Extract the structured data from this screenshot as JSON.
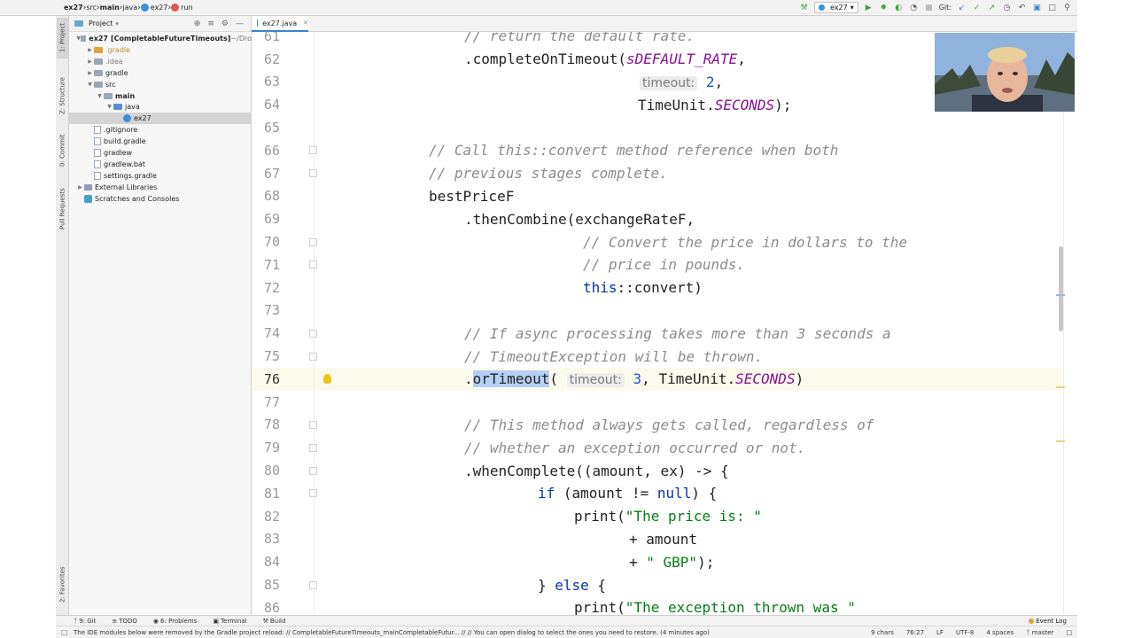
{
  "breadcrumbs": [
    {
      "label": "ex27",
      "icon": "none",
      "bold": true
    },
    {
      "label": "src",
      "icon": "none",
      "bold": false
    },
    {
      "label": "main",
      "icon": "none",
      "bold": true
    },
    {
      "label": "java",
      "icon": "none",
      "bold": false
    },
    {
      "label": "ex27",
      "icon": "class-icon",
      "bold": false
    },
    {
      "label": "run",
      "icon": "method-icon",
      "bold": false
    }
  ],
  "toolbar": {
    "run_config": "ex27",
    "git_label": "Git:"
  },
  "tool_windows": {
    "project": "1: Project",
    "structure": "Z: Structure",
    "commit": "0: Commit",
    "pull_requests": "Pull Requests",
    "favorites": "2: Favorites"
  },
  "project_panel": {
    "title": "Project",
    "tree": [
      {
        "label": "ex27",
        "extra": "[CompletableFutureTimeouts]",
        "suffix": " ~/Dro",
        "depth": 0,
        "arrow": "open",
        "icon": "folder-gray"
      },
      {
        "label": ".gradle",
        "extra": "",
        "suffix": "",
        "depth": 1,
        "arrow": "closed",
        "icon": "folder-orange"
      },
      {
        "label": ".idea",
        "extra": "",
        "suffix": "",
        "depth": 1,
        "arrow": "closed",
        "icon": "folder-gray"
      },
      {
        "label": "gradle",
        "extra": "",
        "suffix": "",
        "depth": 1,
        "arrow": "closed",
        "icon": "folder-gray"
      },
      {
        "label": "src",
        "extra": "",
        "suffix": "",
        "depth": 1,
        "arrow": "open",
        "icon": "folder-gray"
      },
      {
        "label": "main",
        "extra": "",
        "suffix": "",
        "depth": 2,
        "arrow": "open",
        "icon": "folder-gray"
      },
      {
        "label": "java",
        "extra": "",
        "suffix": "",
        "depth": 3,
        "arrow": "open",
        "icon": "folder-blue"
      },
      {
        "label": "ex27",
        "extra": "",
        "suffix": "",
        "depth": 4,
        "arrow": "none",
        "icon": "class",
        "selected": true
      },
      {
        "label": ".gitignore",
        "extra": "",
        "suffix": "",
        "depth": 1,
        "arrow": "none",
        "icon": "file"
      },
      {
        "label": "build.gradle",
        "extra": "",
        "suffix": "",
        "depth": 1,
        "arrow": "none",
        "icon": "file"
      },
      {
        "label": "gradlew",
        "extra": "",
        "suffix": "",
        "depth": 1,
        "arrow": "none",
        "icon": "file"
      },
      {
        "label": "gradlew.bat",
        "extra": "",
        "suffix": "",
        "depth": 1,
        "arrow": "none",
        "icon": "file"
      },
      {
        "label": "settings.gradle",
        "extra": "",
        "suffix": "",
        "depth": 1,
        "arrow": "none",
        "icon": "file"
      },
      {
        "label": "External Libraries",
        "extra": "",
        "suffix": "",
        "depth": 0,
        "arrow": "closed",
        "icon": "library"
      },
      {
        "label": "Scratches and Consoles",
        "extra": "",
        "suffix": "",
        "depth": 0,
        "arrow": "none",
        "icon": "scratch"
      }
    ]
  },
  "editor": {
    "tab_label": "ex27.java",
    "current_line": "76",
    "lines": [
      {
        "n": "61",
        "segs": [
          [
            "c",
            "// return the default rate."
          ]
        ],
        "indent": 524
      },
      {
        "n": "62",
        "segs": [
          [
            "p",
            ".completeOnTimeout("
          ],
          [
            "f",
            "sDEFAULT_RATE"
          ],
          [
            "p",
            ","
          ]
        ],
        "indent": 524
      },
      {
        "n": "63",
        "segs": [
          [
            "h",
            "timeout:"
          ],
          [
            "p",
            " "
          ],
          [
            "n",
            "2"
          ],
          [
            "p",
            ","
          ]
        ],
        "indent": 722
      },
      {
        "n": "64",
        "segs": [
          [
            "p",
            "TimeUnit."
          ],
          [
            "f",
            "SECONDS"
          ],
          [
            "p",
            ");"
          ]
        ],
        "indent": 720
      },
      {
        "n": "65",
        "segs": [],
        "indent": 484
      },
      {
        "n": "66",
        "segs": [
          [
            "c",
            "// Call this::convert method reference when both"
          ]
        ],
        "indent": 484,
        "fold": true
      },
      {
        "n": "67",
        "segs": [
          [
            "c",
            "// previous stages complete."
          ]
        ],
        "indent": 484,
        "fold": true
      },
      {
        "n": "68",
        "segs": [
          [
            "p",
            "bestPriceF"
          ]
        ],
        "indent": 484
      },
      {
        "n": "69",
        "segs": [
          [
            "p",
            ".thenCombine(exchangeRateF,"
          ]
        ],
        "indent": 524
      },
      {
        "n": "70",
        "segs": [
          [
            "c",
            "// Convert the price in dollars to the"
          ]
        ],
        "indent": 658,
        "fold": true
      },
      {
        "n": "71",
        "segs": [
          [
            "c",
            "// price in pounds."
          ]
        ],
        "indent": 658,
        "fold": true
      },
      {
        "n": "72",
        "segs": [
          [
            "k",
            "this"
          ],
          [
            "p",
            "::convert)"
          ]
        ],
        "indent": 658
      },
      {
        "n": "73",
        "segs": [],
        "indent": 484
      },
      {
        "n": "74",
        "segs": [
          [
            "c",
            "// If async processing takes more than 3 seconds a"
          ]
        ],
        "indent": 524,
        "fold": true
      },
      {
        "n": "75",
        "segs": [
          [
            "c",
            "// TimeoutException will be thrown."
          ]
        ],
        "indent": 524,
        "fold": true
      },
      {
        "n": "76",
        "segs": [
          [
            "p",
            "."
          ],
          [
            "s",
            "orTimeout"
          ],
          [
            "p",
            "( "
          ],
          [
            "h",
            "timeout:"
          ],
          [
            "p",
            " "
          ],
          [
            "n",
            "3"
          ],
          [
            "p",
            ", TimeUnit."
          ],
          [
            "f",
            "SECONDS"
          ],
          [
            "p",
            ")"
          ]
        ],
        "indent": 524,
        "current": true,
        "bulb": true
      },
      {
        "n": "77",
        "segs": [],
        "indent": 484
      },
      {
        "n": "78",
        "segs": [
          [
            "c",
            "// This method always gets called, regardless of"
          ]
        ],
        "indent": 524,
        "fold": true
      },
      {
        "n": "79",
        "segs": [
          [
            "c",
            "// whether an exception occurred or not."
          ]
        ],
        "indent": 524,
        "fold": true
      },
      {
        "n": "80",
        "segs": [
          [
            "p",
            ".whenComplete((amount, ex) -> {"
          ]
        ],
        "indent": 524,
        "fold": true
      },
      {
        "n": "81",
        "segs": [
          [
            "k",
            "if"
          ],
          [
            "p",
            " (amount != "
          ],
          [
            "k",
            "null"
          ],
          [
            "p",
            ") {"
          ]
        ],
        "indent": 607,
        "fold": true
      },
      {
        "n": "82",
        "segs": [
          [
            "p",
            "print("
          ],
          [
            "t",
            "\"The price is: \""
          ]
        ],
        "indent": 648
      },
      {
        "n": "83",
        "segs": [
          [
            "p",
            "+ amount"
          ]
        ],
        "indent": 710
      },
      {
        "n": "84",
        "segs": [
          [
            "p",
            "+ "
          ],
          [
            "t",
            "\" GBP\""
          ],
          [
            "p",
            ");"
          ]
        ],
        "indent": 710
      },
      {
        "n": "85",
        "segs": [
          [
            "p",
            "} "
          ],
          [
            "k",
            "else"
          ],
          [
            "p",
            " {"
          ]
        ],
        "indent": 607,
        "fold": true
      },
      {
        "n": "86",
        "segs": [
          [
            "p",
            "print("
          ],
          [
            "t",
            "\"The exception thrown was \""
          ]
        ],
        "indent": 648
      }
    ]
  },
  "bottom_tools": {
    "git": "9: Git",
    "todo": "TODO",
    "problems": "6: Problems",
    "terminal": "Terminal",
    "build": "Build",
    "event_log": "Event Log"
  },
  "status": {
    "message": "The IDE modules below were removed by the Gradle project reload: // CompletableFutureTimeouts_mainCompletableFutur... // // You can open dialog to select the ones you need to restore. (4 minutes ago)",
    "chars": "9 chars",
    "position": "76:27",
    "line_sep": "LF",
    "encoding": "UTF-8",
    "indent": "4 spaces",
    "branch": "master"
  },
  "colors": {
    "comment": "#8c8c8c",
    "keyword": "#0033b3",
    "string": "#067d17",
    "field": "#871094",
    "number": "#1750eb",
    "selection": "#b6cff5"
  }
}
